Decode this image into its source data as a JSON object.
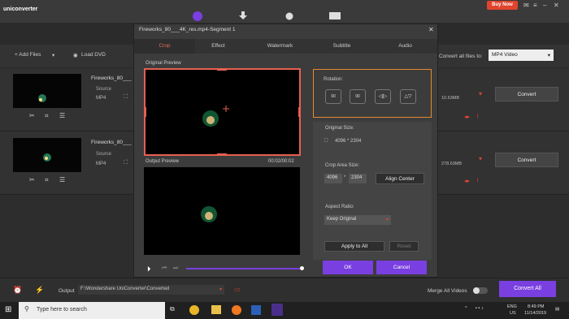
{
  "app": {
    "logo": "uniconverter"
  },
  "topbar": {
    "buy_now": "Buy Now"
  },
  "toolbar": {
    "add_files": "+ Add Files",
    "load_dvd": "Load DVD",
    "convert_all_label": "Convert all files to:",
    "convert_all_value": "MP4 Video"
  },
  "rows": [
    {
      "name": "Fireworks_80___",
      "source": "Source",
      "format": "MP4",
      "size": "10.63MB",
      "convert": "Convert"
    },
    {
      "name": "Fireworks_80___",
      "source": "Source",
      "format": "MP4",
      "size": "278.63MB",
      "convert": "Convert"
    }
  ],
  "bottom": {
    "output_label": "Output",
    "output_path": "F:\\Wondershare UniConverter\\Converted",
    "merge": "Merge All Videos",
    "convert_all": "Convert All"
  },
  "taskbar": {
    "search_placeholder": "Type here to search",
    "lang1": "ENG",
    "lang2": "US",
    "time": "8:49 PM",
    "date": "11/14/2019"
  },
  "dialog": {
    "title": "Fireworks_80___4K_res.mp4-Segment 1",
    "tabs": [
      "Crop",
      "Effect",
      "Watermark",
      "Subtitle",
      "Audio"
    ],
    "original_preview": "Original Preview",
    "output_preview": "Output Preview",
    "timecode": "00:02/00:02",
    "rotation": "Rotation:",
    "rot_icons": [
      "90",
      "90"
    ],
    "original_size_label": "Original Size:",
    "original_size": "4096 * 2304",
    "crop_area_label": "Crop Area Size:",
    "crop_w": "4096",
    "crop_x": "*",
    "crop_h": "2304",
    "align_center": "Align Center",
    "aspect_label": "Aspect Ratio:",
    "aspect_value": "Keep Original",
    "apply_all": "Apply to All",
    "reset": "Reset",
    "ok": "OK",
    "cancel": "Cancel"
  },
  "colors": {
    "accent": "#7a3fe0",
    "highlight": "#e68a2e",
    "active_tab": "#e56a5a",
    "buy": "#e0442d"
  }
}
